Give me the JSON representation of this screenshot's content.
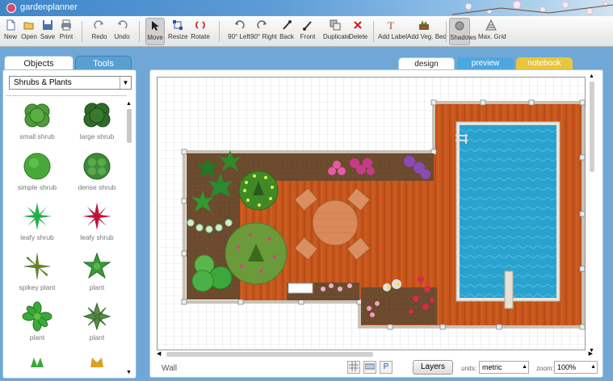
{
  "app": {
    "name": "gardenplanner"
  },
  "toolbar": {
    "buttons": [
      {
        "label": "New",
        "icon": "new-file-icon"
      },
      {
        "label": "Open",
        "icon": "open-folder-icon"
      },
      {
        "label": "Save",
        "icon": "save-disk-icon"
      },
      {
        "label": "Print",
        "icon": "print-icon"
      },
      {
        "label": "Redo",
        "icon": "redo-icon"
      },
      {
        "label": "Undo",
        "icon": "undo-icon"
      },
      {
        "label": "Move",
        "icon": "move-cursor-icon"
      },
      {
        "label": "Resize",
        "icon": "resize-icon"
      },
      {
        "label": "Rotate",
        "icon": "rotate-icon"
      },
      {
        "label": "90° Left",
        "icon": "rotate-left-icon"
      },
      {
        "label": "90° Right",
        "icon": "rotate-right-icon"
      },
      {
        "label": "Back",
        "icon": "send-back-icon"
      },
      {
        "label": "Front",
        "icon": "bring-front-icon"
      },
      {
        "label": "Duplicate",
        "icon": "duplicate-icon"
      },
      {
        "label": "Delete",
        "icon": "delete-x-icon"
      },
      {
        "label": "Add Label",
        "icon": "text-label-icon"
      },
      {
        "label": "Add Veg. Bed",
        "icon": "veg-bed-icon"
      },
      {
        "label": "Shadows",
        "icon": "shadows-icon"
      },
      {
        "label": "Max. Grid",
        "icon": "max-grid-icon"
      }
    ]
  },
  "left_panel": {
    "tabs": [
      "Objects",
      "Tools"
    ],
    "category": "Shrubs & Plants",
    "items": [
      {
        "label": "small shrub"
      },
      {
        "label": "large shrub"
      },
      {
        "label": "simple shrub"
      },
      {
        "label": "dense shrub"
      },
      {
        "label": "leafy shrub"
      },
      {
        "label": "leafy shrub"
      },
      {
        "label": "spikey plant"
      },
      {
        "label": "plant"
      },
      {
        "label": "plant"
      },
      {
        "label": "plant"
      }
    ]
  },
  "view_tabs": [
    "design",
    "preview",
    "notebook"
  ],
  "status": {
    "object": "Wall",
    "layers_label": "Layers",
    "units_label": "units:",
    "units_value": "metric",
    "zoom_label": "zoom:",
    "zoom_value": "100%",
    "view_buttons": [
      "",
      "",
      "P"
    ]
  },
  "colors": {
    "deck": "#c4561a",
    "deck_dark": "#a8410f",
    "pool_water": "#2fa7cf",
    "soil": "#6b4a2e",
    "accent_blue": "#4ea6e0",
    "notebook_tab": "#e7c63d"
  }
}
